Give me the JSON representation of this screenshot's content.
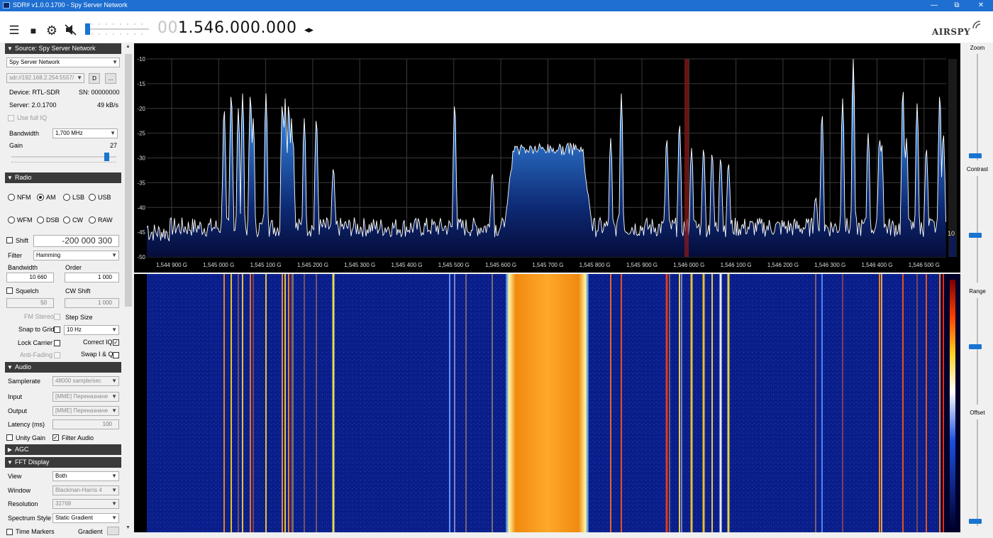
{
  "window": {
    "title": "SDR# v1.0.0.1700 - Spy Server Network",
    "minimize_icon": "minimize-icon",
    "maximize_icon": "restore-icon",
    "close_icon": "close-icon"
  },
  "toolbar": {
    "frequency_dim": "00",
    "frequency_main": "1.546.000.000",
    "freq_arrows": "◂▸",
    "logo": "AIRSPY",
    "icons": [
      "menu-icon",
      "stop-icon",
      "gear-icon",
      "mute-icon"
    ]
  },
  "source": {
    "header": "Source: Spy Server Network",
    "source_type": "Spy Server Network",
    "uri": "sdr://192.168.2.254:5557/",
    "d_button": "D",
    "more_button": "...",
    "device_label": "Device: RTL-SDR",
    "sn_label": "SN: 00000000",
    "server_label": "Server: 2.0.1700",
    "rate_label": "49 kB/s",
    "use_full_iq": "Use full IQ",
    "bandwidth_label": "Bandwidth",
    "bandwidth_value": "1,700 MHz",
    "gain_label": "Gain",
    "gain_value": "27",
    "gain_level": 0.93
  },
  "radio": {
    "header": "Radio",
    "modes": [
      "NFM",
      "AM",
      "LSB",
      "USB",
      "WFM",
      "DSB",
      "CW",
      "RAW"
    ],
    "selected_mode": "AM",
    "shift_label": "Shift",
    "shift_value": "-200 000 300",
    "filter_label": "Filter",
    "filter_value": "Hamming",
    "bandwidth_label": "Bandwidth",
    "bandwidth_value": "10 660",
    "order_label": "Order",
    "order_value": "1 000",
    "squelch_label": "Squelch",
    "squelch_value": "50",
    "cw_shift_label": "CW Shift",
    "cw_shift_value": "1 000",
    "fm_stereo_label": "FM Stereo",
    "step_size_label": "Step Size",
    "snap_label": "Snap to Grid",
    "step_value": "10 Hz",
    "lock_carrier_label": "Lock Carrier",
    "correct_iq_label": "Correct IQ",
    "anti_fading_label": "Anti-Fading",
    "swap_iq_label": "Swap I & Q"
  },
  "audio": {
    "header": "Audio",
    "samplerate_label": "Samplerate",
    "samplerate_value": "48000 sample/sec",
    "input_label": "Input",
    "input_value": "[MME] Переназначе",
    "output_label": "Output",
    "output_value": "[MME] Переназначе",
    "latency_label": "Latency (ms)",
    "latency_value": "100",
    "unity_gain_label": "Unity Gain",
    "filter_audio_label": "Filter Audio"
  },
  "agc": {
    "header": "AGC"
  },
  "fft": {
    "header": "FFT Display",
    "view_label": "View",
    "view_value": "Both",
    "window_label": "Window",
    "window_value": "Blackman-Harris 4",
    "resolution_label": "Resolution",
    "resolution_value": "32768",
    "spectrum_style_label": "Spectrum Style",
    "spectrum_style_value": "Static Gradient",
    "time_markers_label": "Time Markers",
    "gradient_label": "Gradient"
  },
  "right_panel": {
    "zoom_label": "Zoom",
    "contrast_label": "Contrast",
    "range_label": "Range",
    "offset_label": "Offset",
    "zoom_level": 0.05,
    "contrast_level": 0.45,
    "range_level": 0.55,
    "offset_level": 0.05
  },
  "spectrum": {
    "y_ticks": [
      "-10",
      "-15",
      "-20",
      "-25",
      "-30",
      "-35",
      "-40",
      "-45",
      "-50"
    ],
    "x_ticks": [
      "1,544 900 G",
      "1,545 000 G",
      "1,545 100 G",
      "1,545 200 G",
      "1,545 300 G",
      "1,545 400 G",
      "1,545 500 G",
      "1,545 600 G",
      "1,545 700 G",
      "1,545 800 G",
      "1,545 900 G",
      "1,546 000 G",
      "1,546 100 G",
      "1,546 200 G",
      "1,546 300 G",
      "1,546 400 G",
      "1,546 500 G"
    ],
    "marker_value": "10",
    "y_range_db": [
      -50,
      -10
    ],
    "noise_floor_db": -44,
    "center_frequency": "1,546 000 G"
  }
}
